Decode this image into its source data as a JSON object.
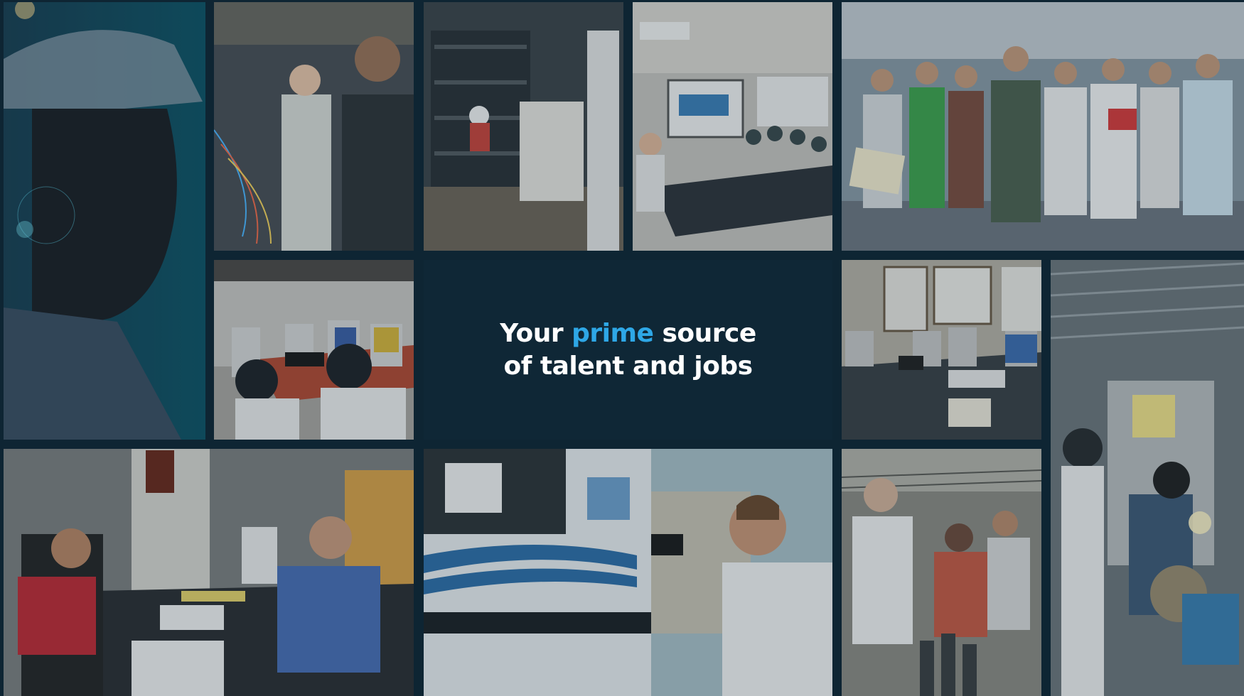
{
  "headline": {
    "before": "Your ",
    "accent": "prime",
    "after_line1": " source",
    "line2": "of talent and jobs"
  },
  "colors": {
    "background": "#0e2533",
    "accent": "#2ea7e6",
    "text": "#ffffff"
  },
  "photos": [
    {
      "name": "worker-portrait-photo",
      "icon": "hard-hat-portrait"
    },
    {
      "name": "electrical-wiring-photo",
      "icon": "wires"
    },
    {
      "name": "warehouse-photo",
      "icon": "shelves"
    },
    {
      "name": "meeting-room-photo",
      "icon": "presentation"
    },
    {
      "name": "group-photo",
      "icon": "people-group"
    },
    {
      "name": "interview-table-photo",
      "icon": "table-meeting"
    },
    {
      "name": "training-room-photo",
      "icon": "table-meeting"
    },
    {
      "name": "welding-photo",
      "icon": "welder"
    },
    {
      "name": "office-interview-photo",
      "icon": "desk"
    },
    {
      "name": "truck-photo",
      "icon": "truck"
    },
    {
      "name": "workshop-photo",
      "icon": "workshop"
    }
  ]
}
